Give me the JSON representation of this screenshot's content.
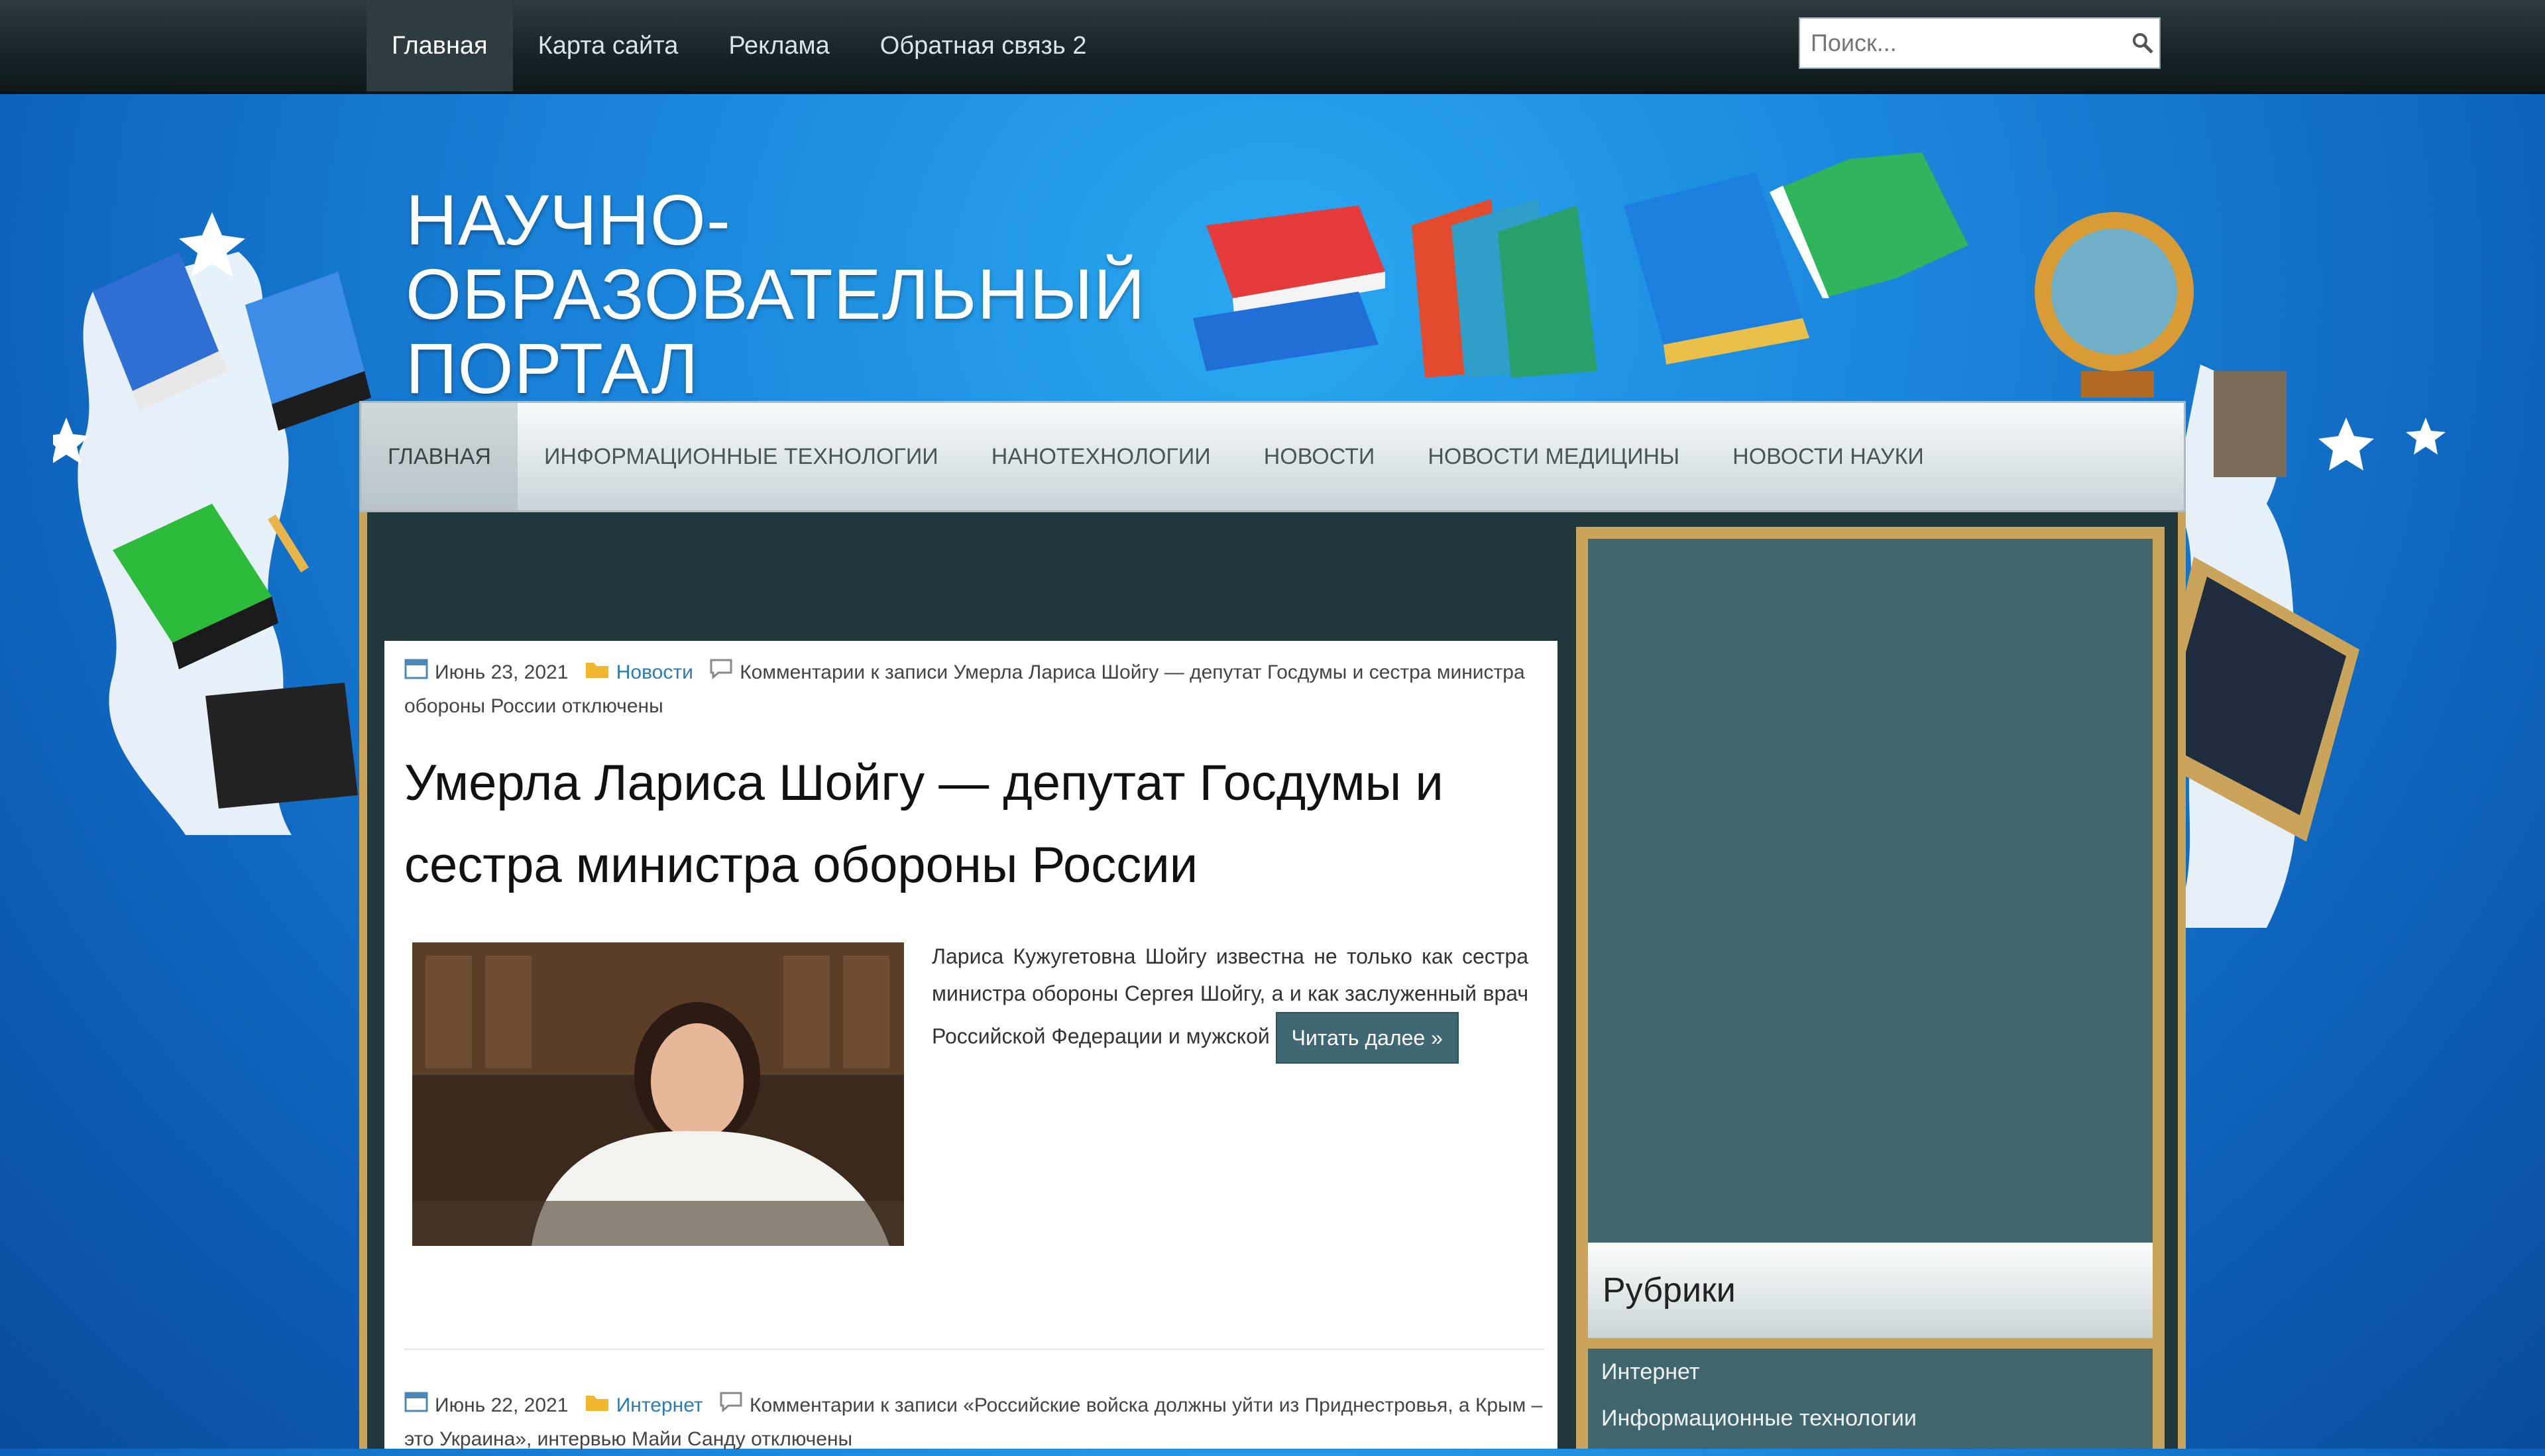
{
  "topnav": {
    "items": [
      {
        "label": "Главная",
        "active": true
      },
      {
        "label": "Карта сайта",
        "active": false
      },
      {
        "label": "Реклама",
        "active": false
      },
      {
        "label": "Обратная связь 2",
        "active": false
      }
    ],
    "search_placeholder": "Поиск...",
    "search_icon": "magnifier-icon"
  },
  "header": {
    "title": "НАУЧНО-ОБРАЗОВАТЕЛЬНЫЙ ПОРТАЛ"
  },
  "mainnav": {
    "items": [
      {
        "label": "ГЛАВНАЯ",
        "active": true
      },
      {
        "label": "ИНФОРМАЦИОННЫЕ ТЕХНОЛОГИИ",
        "active": false
      },
      {
        "label": "НАНОТЕХНОЛОГИИ",
        "active": false
      },
      {
        "label": "НОВОСТИ",
        "active": false
      },
      {
        "label": "НОВОСТИ МЕДИЦИНЫ",
        "active": false
      },
      {
        "label": "НОВОСТИ НАУКИ",
        "active": false
      }
    ]
  },
  "posts": [
    {
      "date": "Июнь 23, 2021",
      "category": "Новости",
      "comments": "Комментарии к записи Умерла Лариса Шойгу — депутат Госдумы и сестра министра обороны России отключены",
      "title": "Умерла Лариса Шойгу — депутат Госдумы и сестра министра обороны России",
      "excerpt": "Лариса Кужугетовна Шойгу известна не только как сестра министра обороны Сергея Шойгу, а и как заслуженный врач Российской Федерации и мужской",
      "read_more": "Читать далее »"
    },
    {
      "date": "Июнь 22, 2021",
      "category": "Интернет",
      "comments": "Комментарии к записи «Российские войска должны уйти из Приднестровья, а Крым – это Украина», интервью Майи Санду отключены"
    }
  ],
  "sidebar": {
    "heading": "Рубрики",
    "items": [
      "Интернет",
      "Информационные технологии"
    ]
  },
  "colors": {
    "accent_blue": "#1a86dc",
    "gold_border": "#c9a45a",
    "dark_panel": "#22373c",
    "sidebar_panel": "#41666e",
    "link": "#2b7bb9"
  }
}
